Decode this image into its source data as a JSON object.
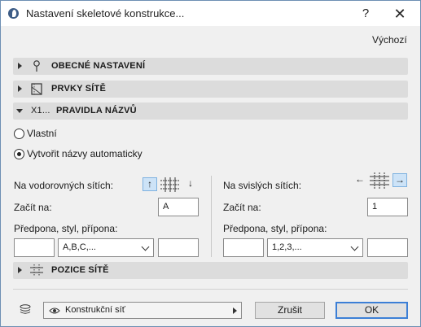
{
  "window": {
    "title": "Nastavení skeletové konstrukce...",
    "help": "?",
    "close": "✕"
  },
  "defaults_label": "Výchozí",
  "sections": {
    "general": "OBECNÉ NASTAVENÍ",
    "grid_elements": "PRVKY SÍTĚ",
    "naming_rules": "PRAVIDLA NÁZVŮ",
    "naming_icon_text": "X1...",
    "grid_position": "POZICE SÍTĚ"
  },
  "naming": {
    "option_custom": "Vlastní",
    "option_auto": "Vytvořit názvy automaticky",
    "selected_option": "auto"
  },
  "horizontal": {
    "label": "Na vodorovných sítích:",
    "start_label": "Začít na:",
    "start_value": "A",
    "format_label": "Předpona, styl, přípona:",
    "prefix": "",
    "style": "A,B,C,...",
    "suffix": "",
    "active_direction": "up"
  },
  "vertical": {
    "label": "Na svislých sítích:",
    "start_label": "Začít na:",
    "start_value": "1",
    "format_label": "Předpona, styl, přípona:",
    "prefix": "",
    "style": "1,2,3,...",
    "suffix": "",
    "active_direction": "right"
  },
  "footer": {
    "layer": "Konstrukční síť",
    "cancel": "Zrušit",
    "ok": "OK"
  }
}
